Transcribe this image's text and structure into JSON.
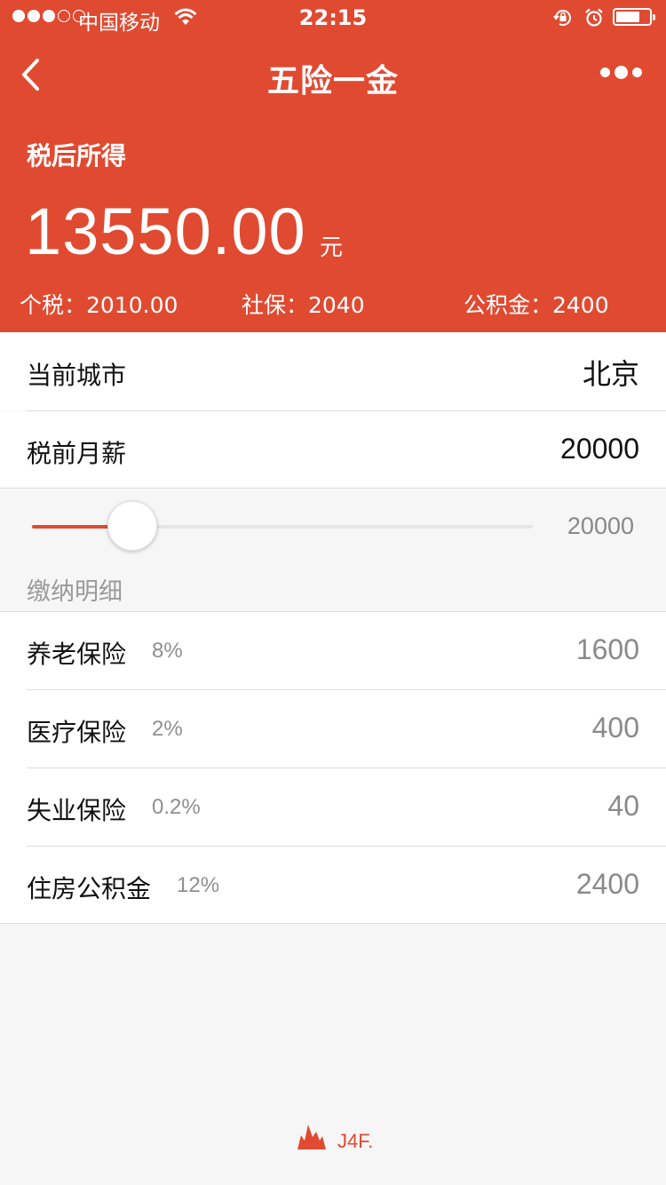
{
  "status_bar": {
    "carrier": "中国移动",
    "time": "22:15"
  },
  "nav": {
    "title": "五险一金"
  },
  "summary": {
    "label": "税后所得",
    "amount": "13550.00",
    "currency": "元",
    "tax": "个税：2010.00",
    "social": "社保：2040",
    "fund": "公积金：2400"
  },
  "city": {
    "label": "当前城市",
    "value": "北京"
  },
  "salary": {
    "label": "税前月薪",
    "value": "20000"
  },
  "slider": {
    "value": "20000",
    "fraction": 0.2
  },
  "details": {
    "title": "缴纳明细",
    "items": [
      {
        "name": "养老保险",
        "rate": "8%",
        "amount": "1600"
      },
      {
        "name": "医疗保险",
        "rate": "2%",
        "amount": "400"
      },
      {
        "name": "失业保险",
        "rate": "0.2%",
        "amount": "40"
      },
      {
        "name": "住房公积金",
        "rate": "12%",
        "amount": "2400"
      }
    ]
  },
  "footer": {
    "brand": "J4F."
  },
  "colors": {
    "accent": "#e04a31",
    "background": "#f6f6f6"
  },
  "icons": [
    "back-icon",
    "more-icon",
    "wifi-icon",
    "rotation-lock-icon",
    "alarm-icon",
    "battery-icon",
    "brand-logo-icon"
  ]
}
